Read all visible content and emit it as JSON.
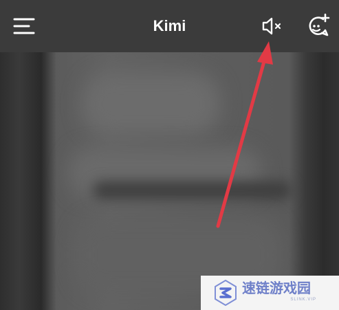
{
  "header": {
    "title": "Kimi"
  },
  "icons": {
    "menu": "hamburger-menu-icon",
    "mute": "speaker-muted-icon",
    "new_chat": "new-chat-icon",
    "arrow": "red-arrow-annotation"
  },
  "colors": {
    "topbar": "#3b3b3b",
    "title": "#ffffff",
    "arrow": "#e23a45",
    "watermark_text": "#6f80c9"
  },
  "watermark": {
    "brand": "速链游戏园",
    "sub": "SLINK.VIP"
  }
}
